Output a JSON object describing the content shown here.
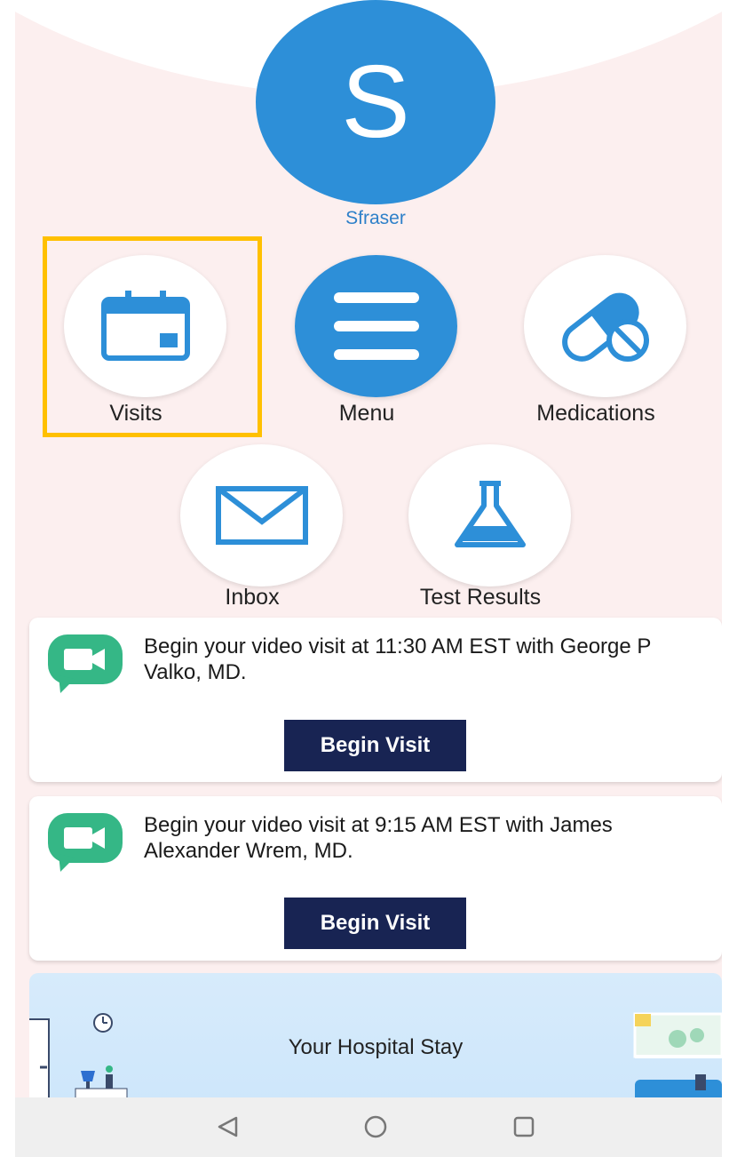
{
  "profile": {
    "initial": "S",
    "username": "Sfraser"
  },
  "shortcuts": [
    {
      "label": "Visits"
    },
    {
      "label": "Menu"
    },
    {
      "label": "Medications"
    },
    {
      "label": "Inbox"
    },
    {
      "label": "Test Results"
    }
  ],
  "video_visits": [
    {
      "message": "Begin your video visit at 11:30 AM EST with George P Valko, MD.",
      "button_label": "Begin Visit"
    },
    {
      "message": "Begin your video visit at 9:15 AM EST with James Alexander Wrem, MD.",
      "button_label": "Begin Visit"
    }
  ],
  "hospital_stay": {
    "title": "Your Hospital Stay"
  },
  "icons": {
    "visits": "calendar-icon",
    "menu": "hamburger-menu-icon",
    "medications": "pill-icon",
    "inbox": "envelope-icon",
    "test_results": "flask-icon",
    "video": "video-camera-chat-icon",
    "nav_back": "triangle-back-icon",
    "nav_home": "circle-home-icon",
    "nav_recent": "square-recent-icon"
  },
  "colors": {
    "accent": "#2d8fd8",
    "button": "#182453",
    "highlight": "#ffc000",
    "video_icon": "#35b786",
    "background": "#fcefef"
  }
}
